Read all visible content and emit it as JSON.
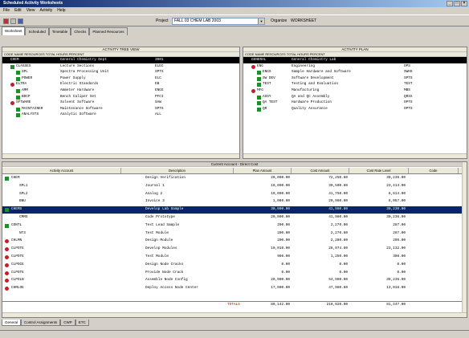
{
  "window": {
    "title": "Scheduled Activity Worksheets",
    "min": "_",
    "max": "□",
    "close": "×"
  },
  "menu": [
    "File",
    "Edit",
    "View",
    "Activity",
    "Help"
  ],
  "toolbar": {
    "project_label": "Project",
    "project_value": "FALL 03 CHEM LAB 2003",
    "organize_label": "Organize",
    "organize_value": "WORKSHEET"
  },
  "tabs": [
    "Worksheet",
    "Scheduled",
    "Timetable",
    "Checks",
    "Planned Resources"
  ],
  "left_pane": {
    "title": "ACTIVITY TREE VIEW",
    "header": "CODE  NAME  RESOURCES  TOTAL HOURS  PERCENT",
    "rows": [
      {
        "code": "CHEM",
        "name": "General Chemistry Dept",
        "val": "3001",
        "bullet": "none",
        "indent": 0,
        "selected": true
      },
      {
        "code": "CLASSES",
        "name": "Lecture Sections",
        "val": "ELEC",
        "bullet": "green",
        "indent": 1
      },
      {
        "code": "SPL",
        "name": "Spectra Processing Unit",
        "val": "SPTS",
        "bullet": "green",
        "indent": 2
      },
      {
        "code": "POWER",
        "name": "Power Supply",
        "val": "ELC",
        "bullet": "green",
        "indent": 2
      },
      {
        "code": "ELTRA",
        "name": "Electric Standards",
        "val": "EB",
        "bullet": "red",
        "indent": 1
      },
      {
        "code": "AMM",
        "name": "Ammeter Hardware",
        "val": "ENGG",
        "bullet": "green",
        "indent": 2
      },
      {
        "code": "BDCP",
        "name": "Bench Caliper Set",
        "val": "PFCI",
        "bullet": "green",
        "indent": 2
      },
      {
        "code": "SFTWARE",
        "name": "Solvent Software",
        "val": "SAW",
        "bullet": "red",
        "indent": 1
      },
      {
        "code": "MAINTAINER",
        "name": "Maintenance Software",
        "val": "SPTS",
        "bullet": "green",
        "indent": 2
      },
      {
        "code": "ANALYSTS",
        "name": "Analytic Software",
        "val": "ALL",
        "bullet": "green",
        "indent": 2
      }
    ]
  },
  "right_pane": {
    "title": "ACTIVITY PLAN",
    "header": "CODE  NAME  RESOURCES  TOTAL HOURS  PERCENT",
    "rows": [
      {
        "code": "GENERAL",
        "name": "General Chemistry Lab",
        "val": "",
        "bullet": "none",
        "indent": 0,
        "selected": true
      },
      {
        "code": "ENG",
        "name": "Engineering",
        "val": "OPS",
        "bullet": "red",
        "indent": 1
      },
      {
        "code": "ENGS",
        "name": "Sample Hardware and Software",
        "val": "SWHS",
        "bullet": "green",
        "indent": 2
      },
      {
        "code": "SW DEV",
        "name": "Software Development",
        "val": "SPTS",
        "bullet": "green",
        "indent": 2
      },
      {
        "code": "TEST",
        "name": "Testing and Evaluation",
        "val": "TEST",
        "bullet": "green",
        "indent": 2
      },
      {
        "code": "MFG",
        "name": "Manufacturing",
        "val": "MBS",
        "bullet": "red",
        "indent": 1
      },
      {
        "code": "ASSY",
        "name": "QA and QC Assembly",
        "val": "QRSX",
        "bullet": "green",
        "indent": 2
      },
      {
        "code": "QA TEST",
        "name": "Hardware Production",
        "val": "OPTS",
        "bullet": "green",
        "indent": 2
      },
      {
        "code": "QR",
        "name": "Quality Assurance",
        "val": "OPTS",
        "bullet": "green",
        "indent": 2
      }
    ]
  },
  "grid": {
    "title": "Current Account - Direct Cost",
    "headers": [
      "Activity Account",
      "Description",
      "Plan Amount",
      "Cost Amount",
      "Cost Rate Level",
      "Code"
    ],
    "rows": [
      {
        "acct": "CHEM",
        "desc": "Design Verification",
        "plan": "20,000.00",
        "cost": "72,250.80",
        "rate": "30,236.00",
        "bullet": "green",
        "indent": 0
      },
      {
        "acct": "SPL1",
        "desc": "Journal 1",
        "plan": "10,000.00",
        "cost": "30,500.80",
        "rate": "23,414.00",
        "bullet": "none",
        "indent": 1
      },
      {
        "acct": "SPL2",
        "desc": "Analog 2",
        "plan": "10,000.00",
        "cost": "41,750.00",
        "rate": "6,814.00",
        "bullet": "none",
        "indent": 1
      },
      {
        "acct": "BNU",
        "desc": "Invoice 3",
        "plan": "1,000.00",
        "cost": "20,980.00",
        "rate": "6,057.00",
        "bullet": "none",
        "indent": 1
      },
      {
        "acct": "CHEMS",
        "desc": "Develop Lab Sample",
        "plan": "30,000.00",
        "cost": "41,980.80",
        "rate": "30,230.00",
        "bullet": "green",
        "indent": 0,
        "selected": true
      },
      {
        "acct": "CMMS",
        "desc": "Code Prototype",
        "plan": "20,000.00",
        "cost": "41,980.00",
        "rate": "30,236.00",
        "bullet": "none",
        "indent": 1
      },
      {
        "acct": "CONTL",
        "desc": "Test Lead Sample",
        "plan": "200.00",
        "cost": "2,270.00",
        "rate": "287.00",
        "bullet": "green",
        "indent": 0
      },
      {
        "acct": "NT3",
        "desc": "Test Module",
        "plan": "200.00",
        "cost": "2,270.80",
        "rate": "287.00",
        "bullet": "none",
        "indent": 1
      },
      {
        "acct": "CHLMN",
        "desc": "Design Module",
        "plan": "200.00",
        "cost": "2,280.80",
        "rate": "205.00",
        "bullet": "red",
        "indent": 0
      },
      {
        "acct": "CLPOTE",
        "desc": "Develop Modules",
        "plan": "10,010.00",
        "cost": "28,974.80",
        "rate": "23,132.00",
        "bullet": "red",
        "indent": 0
      },
      {
        "acct": "CLPOTE",
        "desc": "Test Module",
        "plan": "906.00",
        "cost": "1,250.00",
        "rate": "308.00",
        "bullet": "red",
        "indent": 0
      },
      {
        "acct": "CLPOCE",
        "desc": "Design Node Cracks",
        "plan": "0.00",
        "cost": "0.00",
        "rate": "0.00",
        "bullet": "red",
        "indent": 0
      },
      {
        "acct": "CLPOTE",
        "desc": "Provide Node Crack",
        "plan": "0.00",
        "cost": "0.00",
        "rate": "0.00",
        "bullet": "red",
        "indent": 0
      },
      {
        "acct": "CLPOLB",
        "desc": "Assemble Node Config",
        "plan": "20,000.00",
        "cost": "54,980.00",
        "rate": "30,236.00",
        "bullet": "red",
        "indent": 0
      },
      {
        "acct": "CHMLOE",
        "desc": "Deploy Access Node Center",
        "plan": "17,000.00",
        "cost": "47,980.80",
        "rate": "13,018.00",
        "bullet": "red",
        "indent": 0
      }
    ],
    "totals": {
      "label": "TOTALS",
      "plan": "80,142.00",
      "cost": "210,920.00",
      "rate": "81,447.00"
    }
  },
  "bottom_tabs": [
    "General",
    "Control Assignments",
    "CWP",
    "ETC"
  ],
  "colors": {
    "tree_green": "#1d8f2a",
    "tree_red": "#c0202a",
    "selected_row": "#0a246a"
  }
}
